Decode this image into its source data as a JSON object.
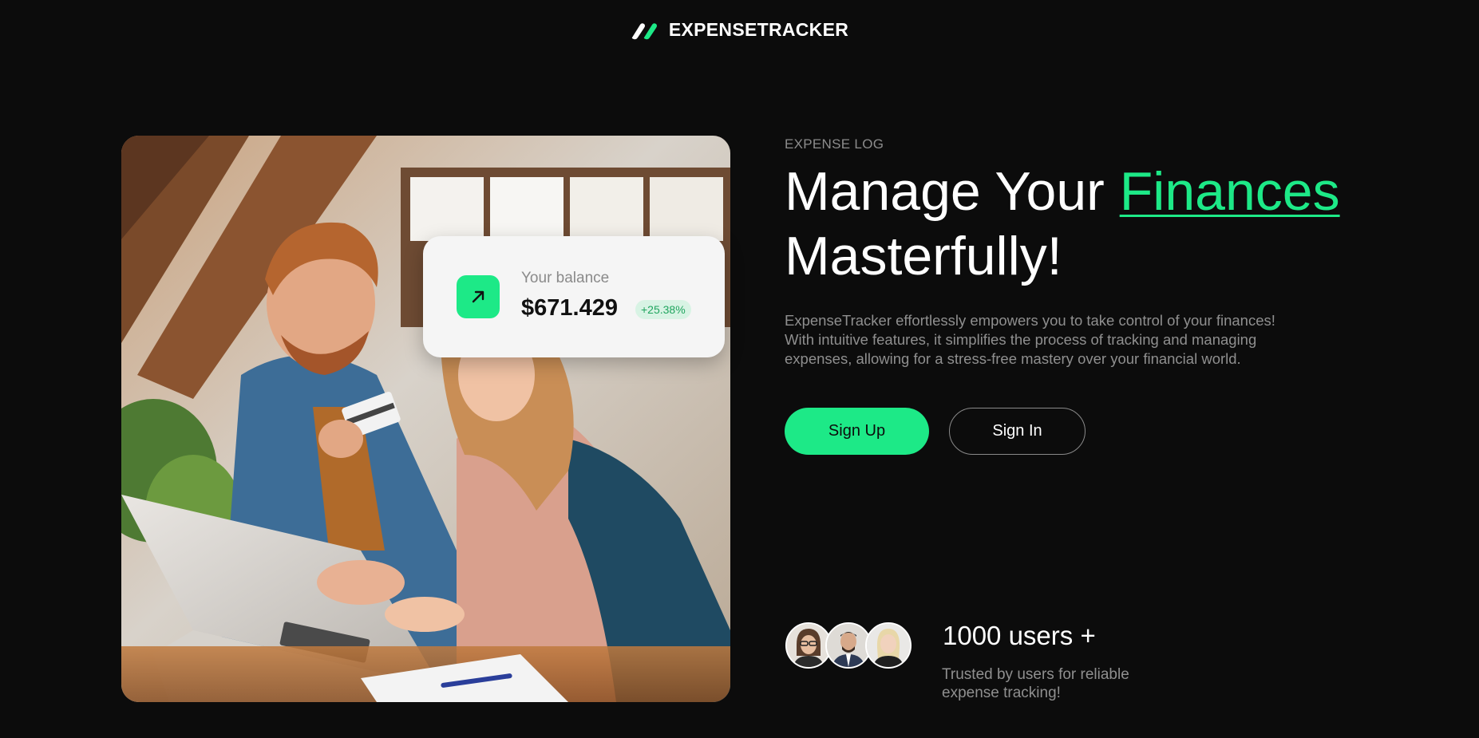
{
  "brand": {
    "name": "EXPENSETRACKER",
    "logo_icon": "stripes-logo-icon",
    "accent_color": "#1de987"
  },
  "balance_card": {
    "label": "Your balance",
    "amount": "$671.429",
    "change": "+25.38%",
    "icon": "arrow-up-right-icon"
  },
  "hero": {
    "eyebrow": "EXPENSE LOG",
    "headline_part1": "Manage Your ",
    "headline_accent": "Finances",
    "headline_part2": "Masterfully!",
    "description": "ExpenseTracker effortlessly empowers you to take control of your finances! With intuitive features, it simplifies the process of tracking and managing expenses, allowing for a stress-free mastery over your financial world."
  },
  "actions": {
    "sign_up_label": "Sign Up",
    "sign_in_label": "Sign In"
  },
  "social_proof": {
    "count": "1000 users +",
    "note": "Trusted by users for reliable expense tracking!",
    "avatars": [
      "avatar-woman-glasses",
      "avatar-man-beard",
      "avatar-woman-blonde"
    ]
  }
}
